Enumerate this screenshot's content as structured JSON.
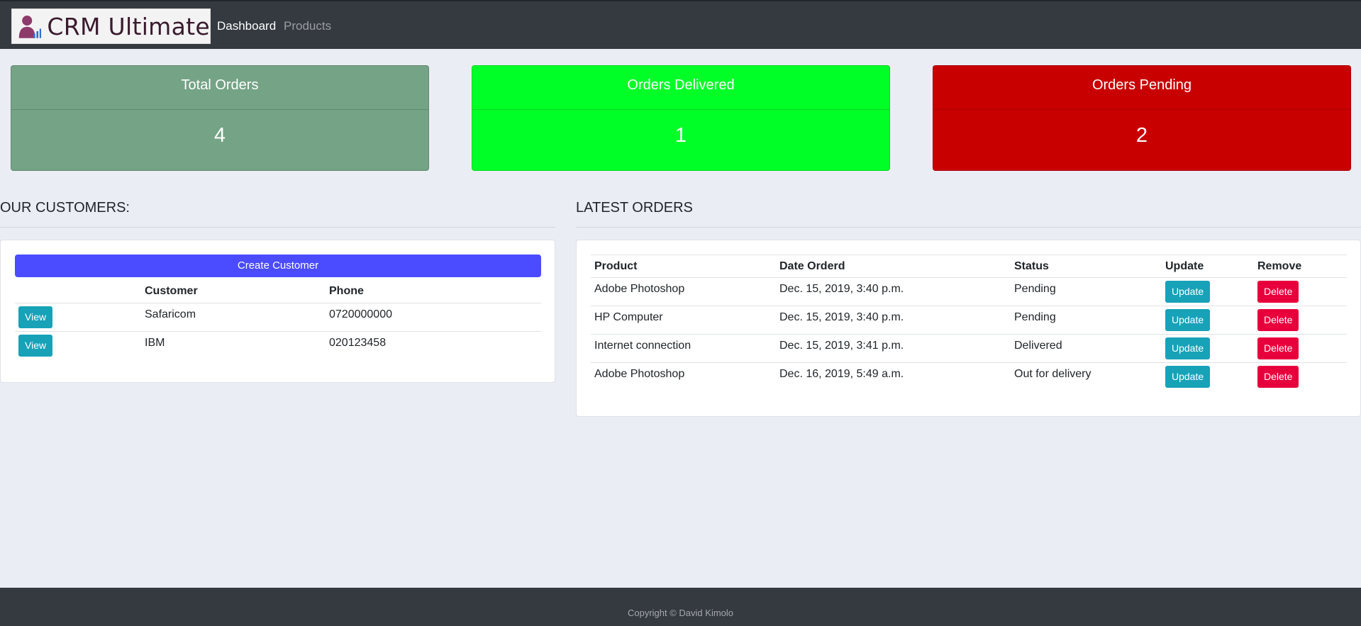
{
  "navbar": {
    "brand": "CRM Ultimate",
    "links": [
      {
        "label": "Dashboard",
        "active": true
      },
      {
        "label": "Products",
        "active": false
      }
    ]
  },
  "stats": [
    {
      "title": "Total Orders",
      "value": "4",
      "color": "#74a385"
    },
    {
      "title": "Orders Delivered",
      "value": "1",
      "color": "#00ff26"
    },
    {
      "title": "Orders Pending",
      "value": "2",
      "color": "#c80000"
    }
  ],
  "customers": {
    "title": "OUR CUSTOMERS:",
    "create_label": "Create Customer",
    "columns": [
      "",
      "Customer",
      "Phone"
    ],
    "rows": [
      {
        "action": "View",
        "name": "Safaricom",
        "phone": "0720000000"
      },
      {
        "action": "View",
        "name": "IBM",
        "phone": "020123458"
      }
    ]
  },
  "orders": {
    "title": "LATEST ORDERS",
    "columns": [
      "Product",
      "Date Orderd",
      "Status",
      "Update",
      "Remove"
    ],
    "rows": [
      {
        "product": "Adobe Photoshop",
        "date": "Dec. 15, 2019, 3:40 p.m.",
        "status": "Pending",
        "update": "Update",
        "remove": "Delete"
      },
      {
        "product": "HP Computer",
        "date": "Dec. 15, 2019, 3:40 p.m.",
        "status": "Pending",
        "update": "Update",
        "remove": "Delete"
      },
      {
        "product": "Internet connection",
        "date": "Dec. 15, 2019, 3:41 p.m.",
        "status": "Delivered",
        "update": "Update",
        "remove": "Delete"
      },
      {
        "product": "Adobe Photoshop",
        "date": "Dec. 16, 2019, 5:49 a.m.",
        "status": "Out for delivery",
        "update": "Update",
        "remove": "Delete"
      }
    ]
  },
  "footer": {
    "text": "Copyright © David Kimolo"
  },
  "colors": {
    "navbar": "#343a40",
    "primary_button": "#4b4cff",
    "info_button": "#17a2b8",
    "danger_button": "#e8003c"
  }
}
